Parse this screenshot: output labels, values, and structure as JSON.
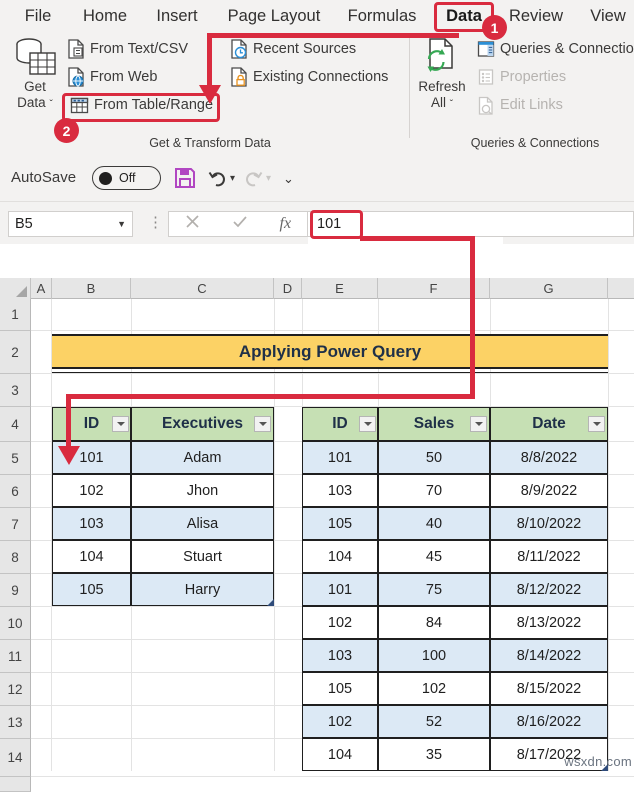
{
  "app": {
    "autosave_label": "AutoSave",
    "autosave_state": "Off",
    "accent_red": "#d92b3f",
    "title_fill": "#FCD265",
    "header_fill": "#C6E0B4",
    "band_fill": "#DCE9F5",
    "watermark": "wsxdn.com"
  },
  "ribbon": {
    "tabs": [
      {
        "label": "File",
        "active": false
      },
      {
        "label": "Home",
        "active": false
      },
      {
        "label": "Insert",
        "active": false
      },
      {
        "label": "Page Layout",
        "active": false
      },
      {
        "label": "Formulas",
        "active": false
      },
      {
        "label": "Data",
        "active": true
      },
      {
        "label": "Review",
        "active": false
      },
      {
        "label": "View",
        "active": false
      }
    ],
    "groups": [
      {
        "label": "Get & Transform Data"
      },
      {
        "label": "Queries & Connections"
      }
    ],
    "get_data": {
      "line1": "Get",
      "line2": "Data",
      "caret": "ˇ"
    },
    "refresh_all": {
      "line1": "Refresh",
      "line2": "All",
      "caret": "ˇ"
    },
    "commands": [
      {
        "label": "From Text/CSV",
        "icon": "file-text-icon",
        "disabled": false
      },
      {
        "label": "From Web",
        "icon": "file-globe-icon",
        "disabled": false
      },
      {
        "label": "From Table/Range",
        "icon": "table-grid-icon",
        "disabled": false
      },
      {
        "label": "Recent Sources",
        "icon": "file-clock-icon",
        "disabled": false
      },
      {
        "label": "Existing Connections",
        "icon": "file-lock-icon",
        "disabled": false
      },
      {
        "label": "Queries & Connections",
        "icon": "queries-panel-icon",
        "disabled": false
      },
      {
        "label": "Properties",
        "icon": "properties-icon",
        "disabled": true
      },
      {
        "label": "Edit Links",
        "icon": "edit-links-icon",
        "disabled": true
      }
    ]
  },
  "formula_bar": {
    "name_box": "B5",
    "cancel_icon": "cancel-x-icon",
    "enter_icon": "check-icon",
    "function_icon": "fx-icon",
    "value": "101"
  },
  "sheet": {
    "columns": [
      "A",
      "B",
      "C",
      "D",
      "E",
      "F",
      "G"
    ],
    "rows": [
      "1",
      "2",
      "3",
      "4",
      "5",
      "6",
      "7",
      "8",
      "9",
      "10",
      "11",
      "12",
      "13",
      "14"
    ],
    "title_cell": "Applying Power Query",
    "left_table": {
      "headers": [
        "ID",
        "Executives"
      ],
      "rows": [
        [
          "101",
          "Adam"
        ],
        [
          "102",
          "Jhon"
        ],
        [
          "103",
          "Alisa"
        ],
        [
          "104",
          "Stuart"
        ],
        [
          "105",
          "Harry"
        ]
      ]
    },
    "right_table": {
      "headers": [
        "ID",
        "Sales",
        "Date"
      ],
      "rows": [
        [
          "101",
          "50",
          "8/8/2022"
        ],
        [
          "103",
          "70",
          "8/9/2022"
        ],
        [
          "105",
          "40",
          "8/10/2022"
        ],
        [
          "104",
          "45",
          "8/11/2022"
        ],
        [
          "101",
          "75",
          "8/12/2022"
        ],
        [
          "102",
          "84",
          "8/13/2022"
        ],
        [
          "103",
          "100",
          "8/14/2022"
        ],
        [
          "105",
          "102",
          "8/15/2022"
        ],
        [
          "102",
          "52",
          "8/16/2022"
        ],
        [
          "104",
          "35",
          "8/17/2022"
        ]
      ]
    }
  },
  "annotations": {
    "step1": "1",
    "step2": "2"
  }
}
